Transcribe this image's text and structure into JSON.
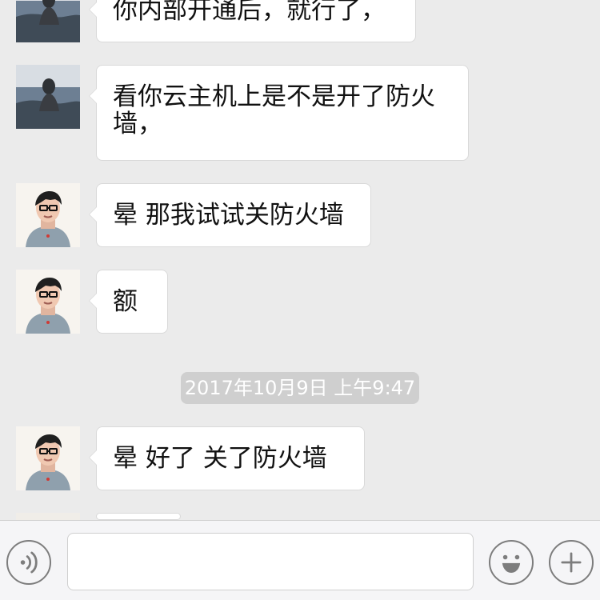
{
  "messages": [
    {
      "text": "你内部开通后，就行了，",
      "avatar": "sea-avatar"
    },
    {
      "text": "看你云主机上是不是开了防火墙，",
      "avatar": "sea-avatar"
    },
    {
      "text": "晕 那我试试关防火墙",
      "avatar": "person-avatar"
    },
    {
      "text": "额",
      "avatar": "person-avatar"
    },
    {
      "text": "晕 好了 关了防火墙",
      "avatar": "person-avatar"
    }
  ],
  "timestamp": "2017年10月9日 上午9:47",
  "icons": {
    "voice": "voice-icon",
    "emoji": "emoji-icon",
    "plus": "plus-icon"
  },
  "colors": {
    "background": "#ebebeb",
    "bubble": "#ffffff",
    "timestamp_bg": "#cfcfcf"
  }
}
